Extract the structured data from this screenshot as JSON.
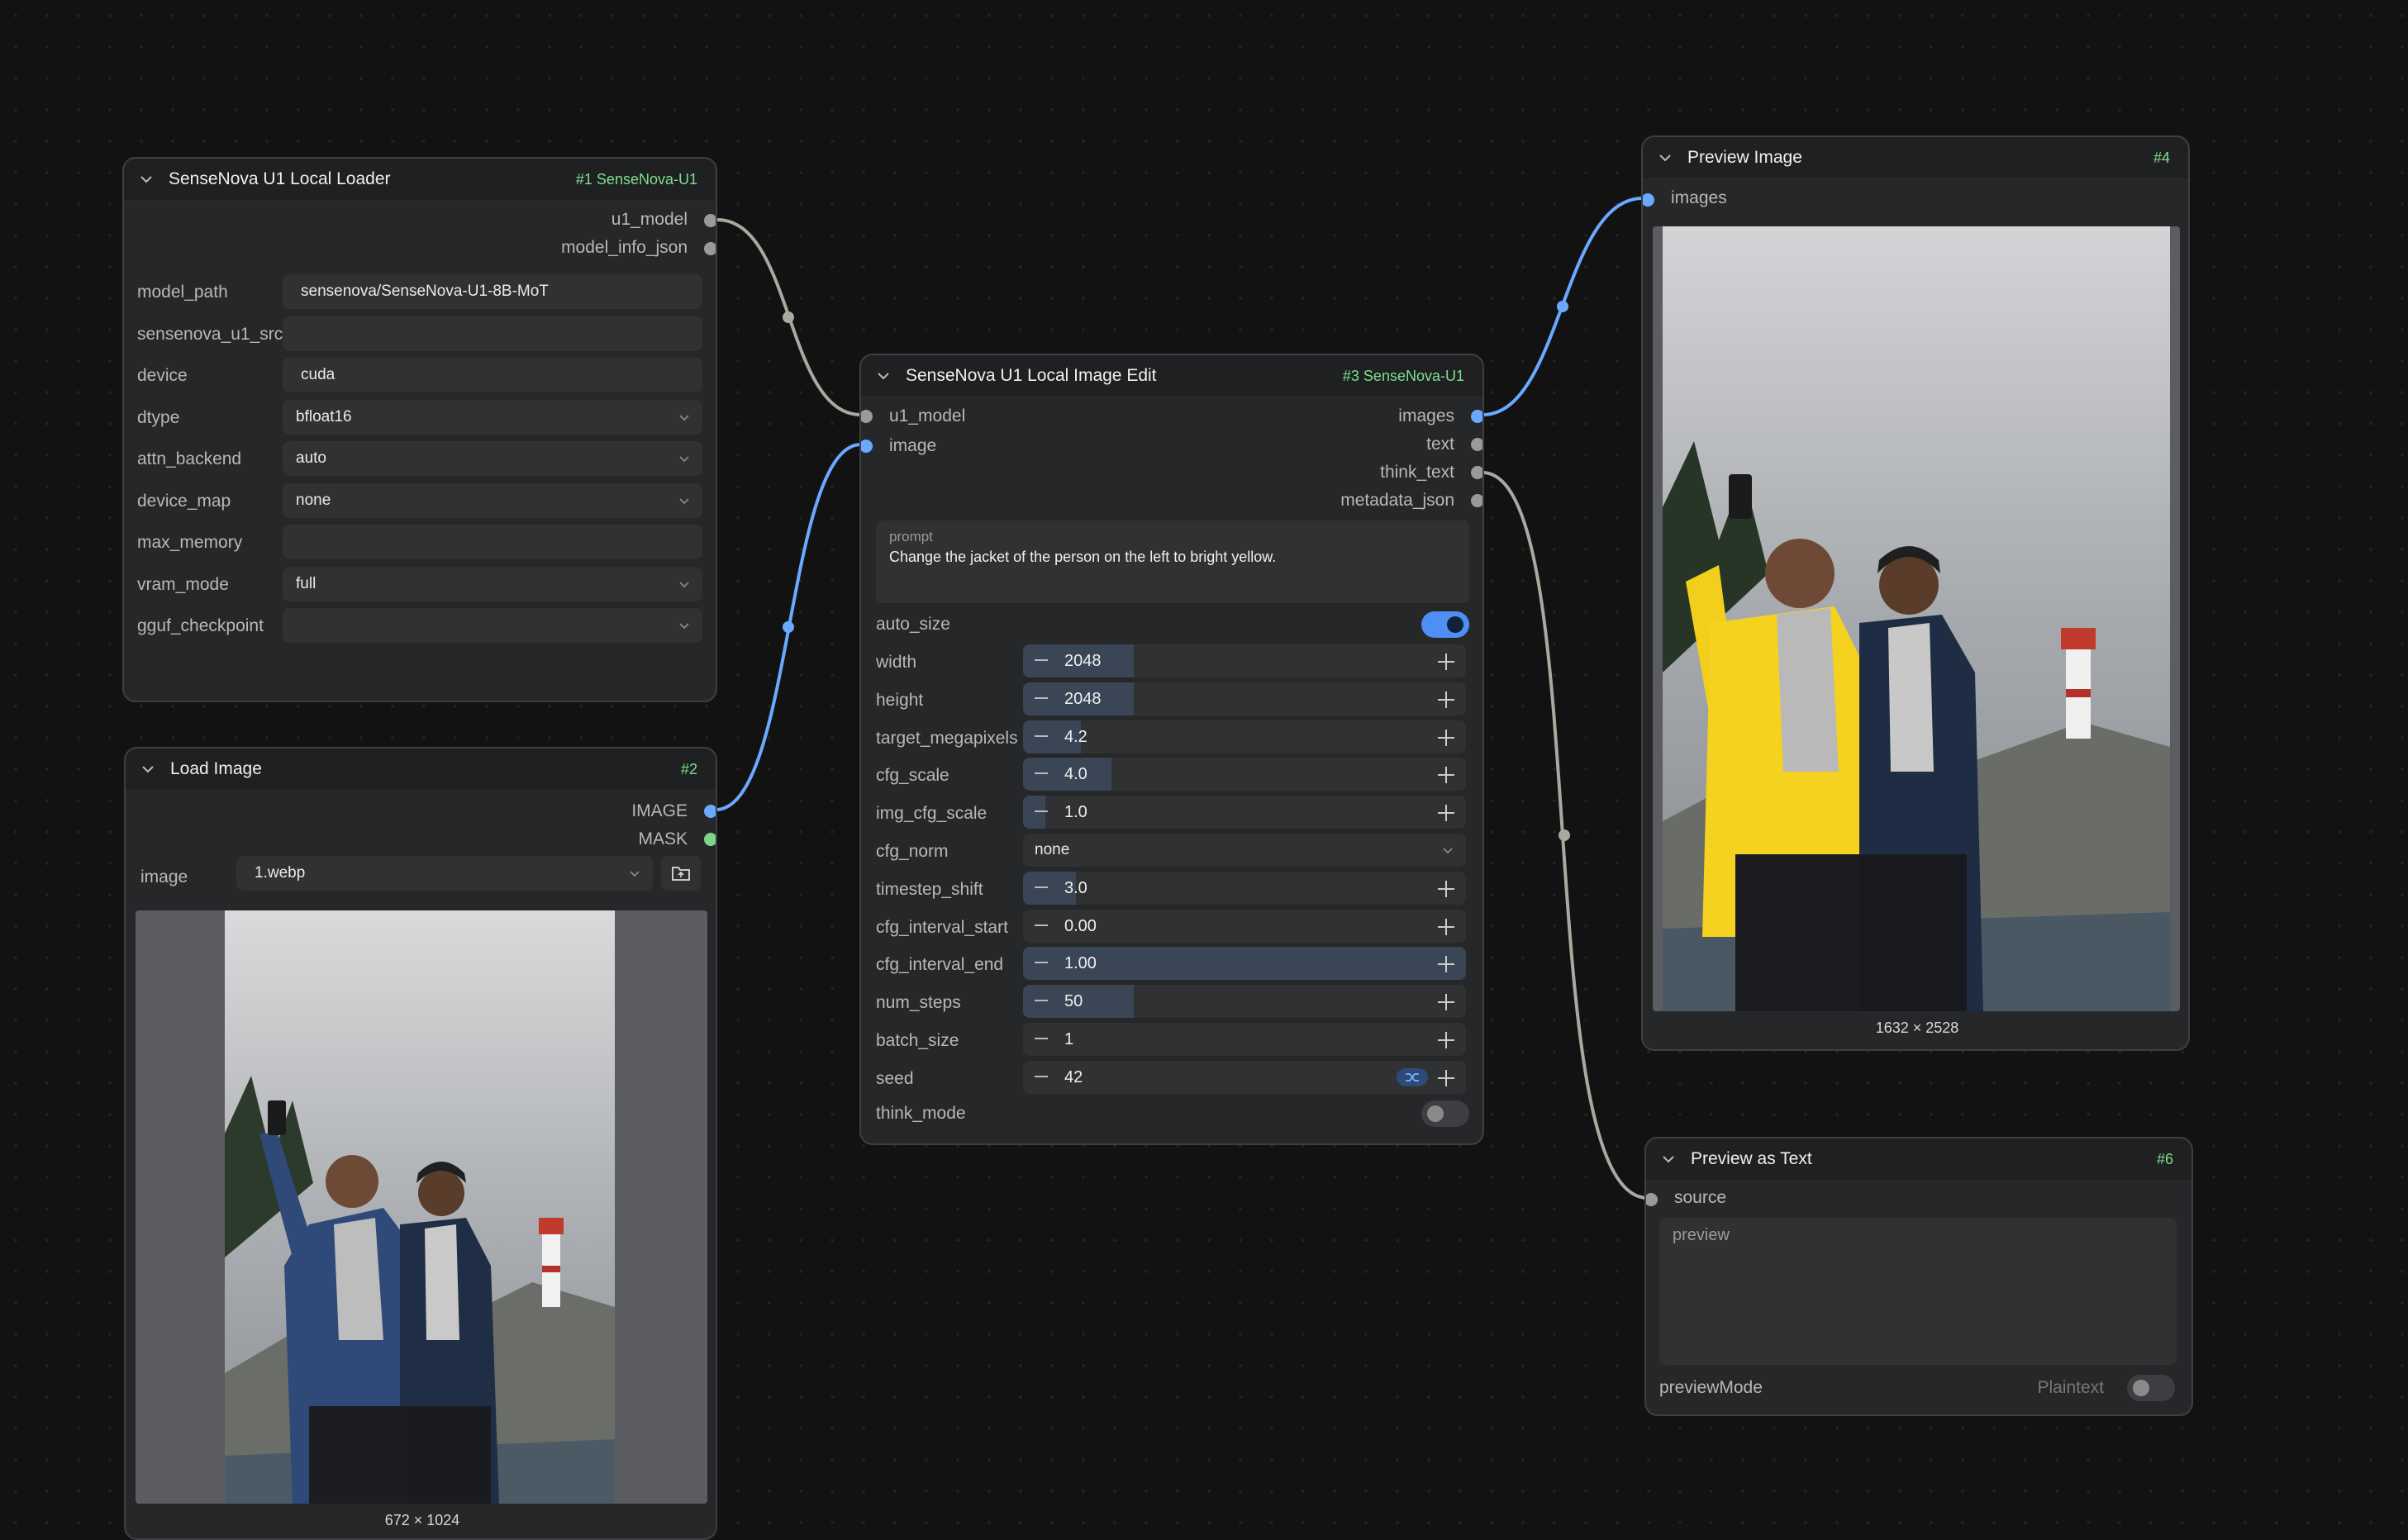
{
  "canvas": {
    "bg": "#121212",
    "wire_blue": "#6aa9ff",
    "wire_gray": "#a9a9a0",
    "node_id_color": "#7ee08f"
  },
  "loader": {
    "title": "SenseNova U1 Local Loader",
    "id": "#1 SenseNova-U1",
    "outputs": [
      "u1_model",
      "model_info_json"
    ],
    "widgets": [
      {
        "label": "model_path",
        "value": "sensenova/SenseNova-U1-8B-MoT",
        "kind": "text"
      },
      {
        "label": "sensenova_u1_src",
        "value": "",
        "kind": "text"
      },
      {
        "label": "device",
        "value": "cuda",
        "kind": "text"
      },
      {
        "label": "dtype",
        "value": "bfloat16",
        "kind": "combo"
      },
      {
        "label": "attn_backend",
        "value": "auto",
        "kind": "combo"
      },
      {
        "label": "device_map",
        "value": "none",
        "kind": "combo"
      },
      {
        "label": "max_memory",
        "value": "",
        "kind": "text"
      },
      {
        "label": "vram_mode",
        "value": "full",
        "kind": "combo"
      },
      {
        "label": "gguf_checkpoint",
        "value": "",
        "kind": "combo"
      }
    ]
  },
  "load_image": {
    "title": "Load Image",
    "id": "#2",
    "outputs": [
      "IMAGE",
      "MASK"
    ],
    "image_label": "image",
    "image_value": "1.webp",
    "caption": "672 × 1024"
  },
  "edit": {
    "title": "SenseNova U1 Local Image Edit",
    "id": "#3 SenseNova-U1",
    "inputs": [
      "u1_model",
      "image"
    ],
    "outputs": [
      "images",
      "text",
      "think_text",
      "metadata_json"
    ],
    "prompt_label": "prompt",
    "prompt_text": "Change the jacket of the person on the left to bright yellow.",
    "auto_size_label": "auto_size",
    "auto_size": true,
    "params": [
      {
        "label": "width",
        "value": "2048",
        "fill": 0.25,
        "kind": "num"
      },
      {
        "label": "height",
        "value": "2048",
        "fill": 0.25,
        "kind": "num"
      },
      {
        "label": "target_megapixels",
        "value": "4.2",
        "fill": 0.13,
        "kind": "num"
      },
      {
        "label": "cfg_scale",
        "value": "4.0",
        "fill": 0.2,
        "kind": "num"
      },
      {
        "label": "img_cfg_scale",
        "value": "1.0",
        "fill": 0.05,
        "kind": "num"
      },
      {
        "label": "cfg_norm",
        "value": "none",
        "fill": 0,
        "kind": "combo"
      },
      {
        "label": "timestep_shift",
        "value": "3.0",
        "fill": 0.12,
        "kind": "num"
      },
      {
        "label": "cfg_interval_start",
        "value": "0.00",
        "fill": 0,
        "kind": "num"
      },
      {
        "label": "cfg_interval_end",
        "value": "1.00",
        "fill": 1.0,
        "kind": "num"
      },
      {
        "label": "num_steps",
        "value": "50",
        "fill": 0.25,
        "kind": "num"
      },
      {
        "label": "batch_size",
        "value": "1",
        "fill": 0,
        "kind": "num"
      },
      {
        "label": "seed",
        "value": "42",
        "fill": 0,
        "kind": "num"
      }
    ],
    "think_mode_label": "think_mode",
    "think_mode": false
  },
  "preview_image": {
    "title": "Preview Image",
    "id": "#4",
    "input": "images",
    "caption": "1632 × 2528"
  },
  "preview_text": {
    "title": "Preview as Text",
    "id": "#6",
    "input": "source",
    "placeholder": "preview",
    "mode_label": "previewMode",
    "mode_value": "Plaintext"
  }
}
